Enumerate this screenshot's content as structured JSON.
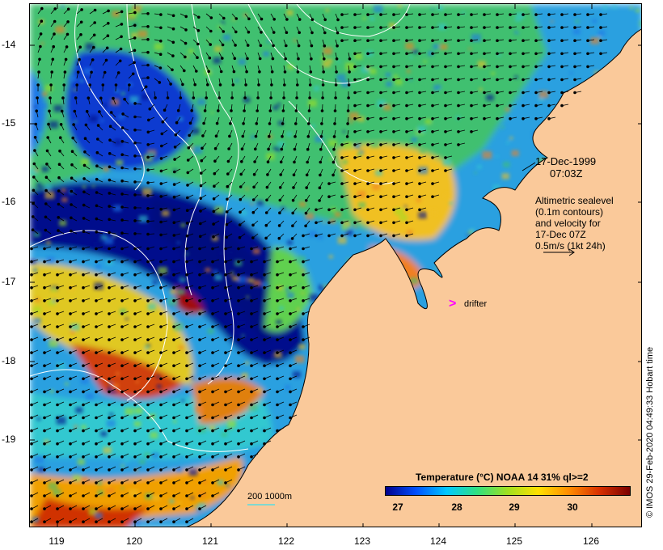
{
  "map": {
    "lon_ticks": [
      "119",
      "120",
      "121",
      "122",
      "123",
      "124",
      "125",
      "126"
    ],
    "lat_ticks": [
      "-14",
      "-15",
      "-16",
      "-17",
      "-18",
      "-19"
    ],
    "colors": {
      "land": "#fac99a",
      "coast": "#000000",
      "contour": "#ffffff",
      "arrow": "#000000",
      "scale": "#7fd8d0",
      "drifter": "#ff00ff"
    }
  },
  "annotation": {
    "date": "17-Dec-1999",
    "time": "07:03Z",
    "legend_lines": [
      "Altimetric sealevel",
      "(0.1m contours)",
      "and velocity for",
      "17-Dec 07Z",
      "0.5m/s (1kt 24h)"
    ]
  },
  "drifter": {
    "marker": ">",
    "label": "drifter"
  },
  "scale": {
    "label": "200  1000m"
  },
  "colorbar": {
    "title": "Temperature (°C) NOAA 14 31% ql>=2",
    "ticks": [
      "27",
      "28",
      "29",
      "30"
    ],
    "colors": [
      "#00008c",
      "#0050ff",
      "#00c8ff",
      "#30e080",
      "#a0e020",
      "#ffe000",
      "#ff8c00",
      "#d83000",
      "#7a0000"
    ]
  },
  "credit": "© IMOS 29-Feb-2020 04:49:33 Hobart time"
}
